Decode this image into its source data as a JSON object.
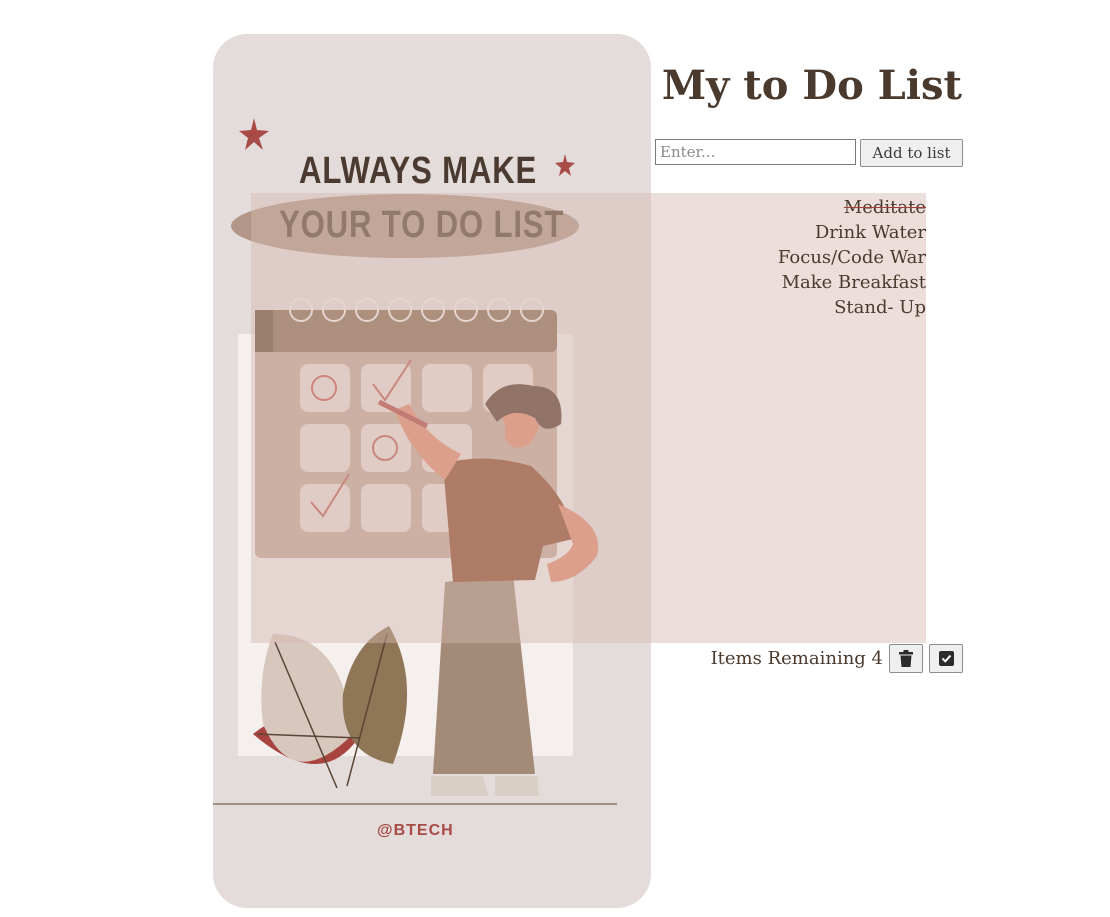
{
  "illustration": {
    "line1": "ALWAYS MAKE",
    "line2": "YOUR TO DO LIST",
    "handle": "@BTECH"
  },
  "header": {
    "title": "My to Do List"
  },
  "form": {
    "placeholder": "Enter...",
    "add_label": "Add to list"
  },
  "todos": [
    {
      "text": "Meditate",
      "done": true
    },
    {
      "text": "Drink Water",
      "done": false
    },
    {
      "text": "Focus/Code War",
      "done": false
    },
    {
      "text": "Make Breakfast",
      "done": false
    },
    {
      "text": "Stand- Up",
      "done": false
    }
  ],
  "footer": {
    "remaining_label": "Items Remaining 4"
  },
  "icons": {
    "delete": "trash-icon",
    "complete": "check-square-icon"
  },
  "colors": {
    "card_bg": "#e3dcda",
    "panel_bg": "#d5b9b0",
    "text": "#4a3a2e",
    "accent": "#a3403b"
  }
}
